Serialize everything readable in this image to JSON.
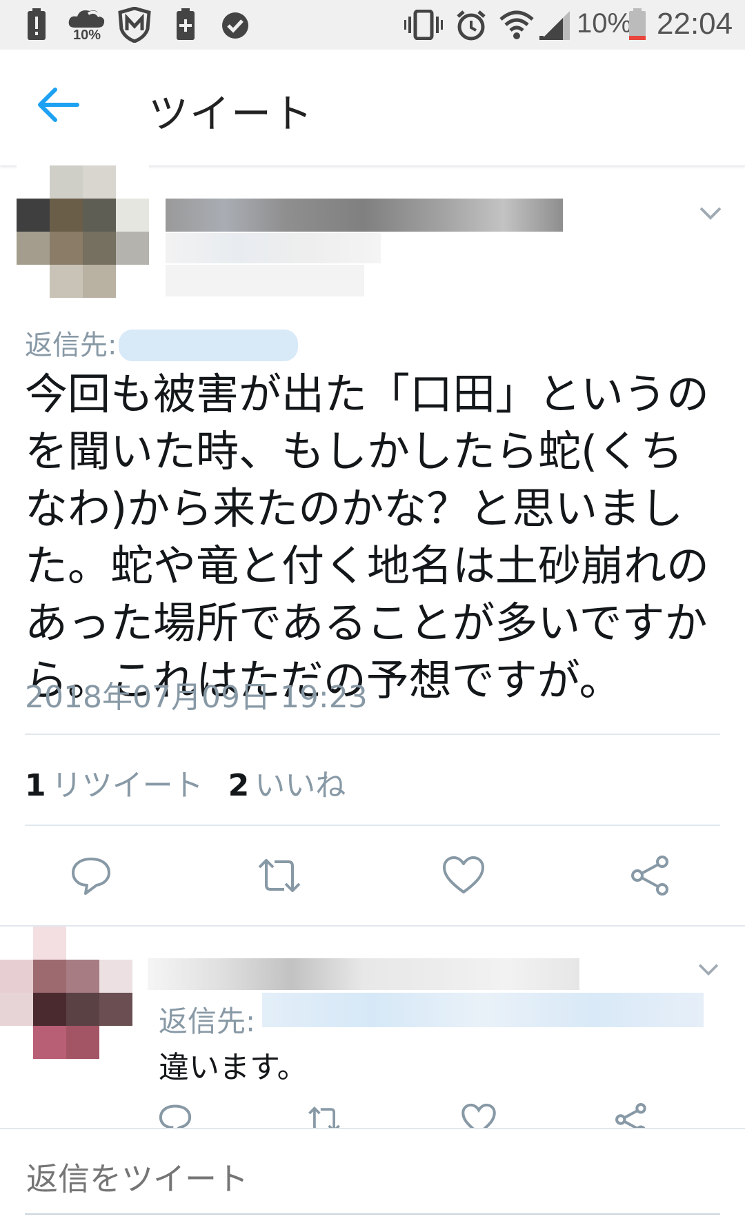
{
  "status_bar": {
    "battery_small_label": "10%",
    "battery_percent": "10%",
    "time": "22:04",
    "icons": [
      "alert-icon",
      "cloud-icon",
      "shield-icon",
      "battery-plus-icon",
      "check-circle-icon",
      "vibrate-icon",
      "alarm-icon",
      "wifi-icon",
      "signal-icon",
      "battery-icon"
    ]
  },
  "header": {
    "title": "ツイート",
    "back_icon": "arrow-left-icon",
    "accent_color": "#1da1f2"
  },
  "main_tweet": {
    "reply_prefix": "返信先:",
    "text": "今回も被害が出た「口田」というのを聞いた時、もしかしたら蛇(くちなわ)から来たのかな？と思いました。蛇や竜と付く地名は土砂崩れのあった場所であることが多いですから。これはただの予想ですが。",
    "timestamp": "2018年07月09日 19:23",
    "retweets_count": "1",
    "retweets_label": "リツイート",
    "likes_count": "2",
    "likes_label": "いいね",
    "actions": [
      "reply-icon",
      "retweet-icon",
      "like-icon",
      "share-icon"
    ]
  },
  "reply_tweet": {
    "reply_prefix": "返信先:",
    "text": "違います。"
  },
  "compose": {
    "placeholder": "返信をツイート"
  }
}
